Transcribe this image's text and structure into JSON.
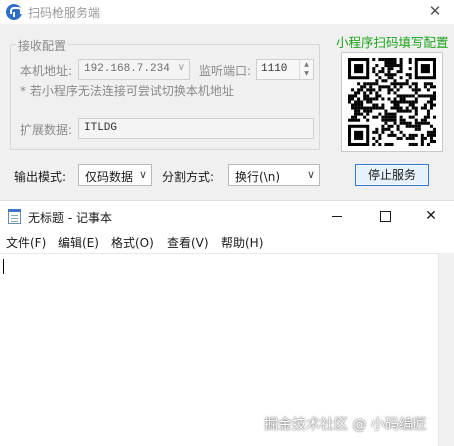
{
  "service_window": {
    "title": "扫码枪服务端",
    "close_glyph": "✕",
    "receive_group": {
      "legend": "接收配置",
      "host_label": "本机地址:",
      "host_value": "192.168.7.234",
      "port_label": "监听端口:",
      "port_value": "1110",
      "hint": "* 若小程序无法连接可尝试切换本机地址",
      "ext_label": "扩展数据:",
      "ext_value": "ITLDG"
    },
    "qr_caption": "小程序扫码填写配置",
    "output_mode_label": "输出模式:",
    "output_mode_value": "仅码数据",
    "split_label": "分割方式:",
    "split_value": "换行(\\n)",
    "stop_button": "停止服务",
    "colors": {
      "qr_caption": "#19a319",
      "button_border": "#2f7ad6"
    }
  },
  "notepad": {
    "title": "无标题 - 记事本",
    "menus": [
      "文件(F)",
      "编辑(E)",
      "格式(O)",
      "查看(V)",
      "帮助(H)"
    ],
    "window_icons": [
      "minimize-icon",
      "maximize-icon",
      "close-icon"
    ]
  },
  "watermark": "掘金技术社区 @ 小码编匠"
}
